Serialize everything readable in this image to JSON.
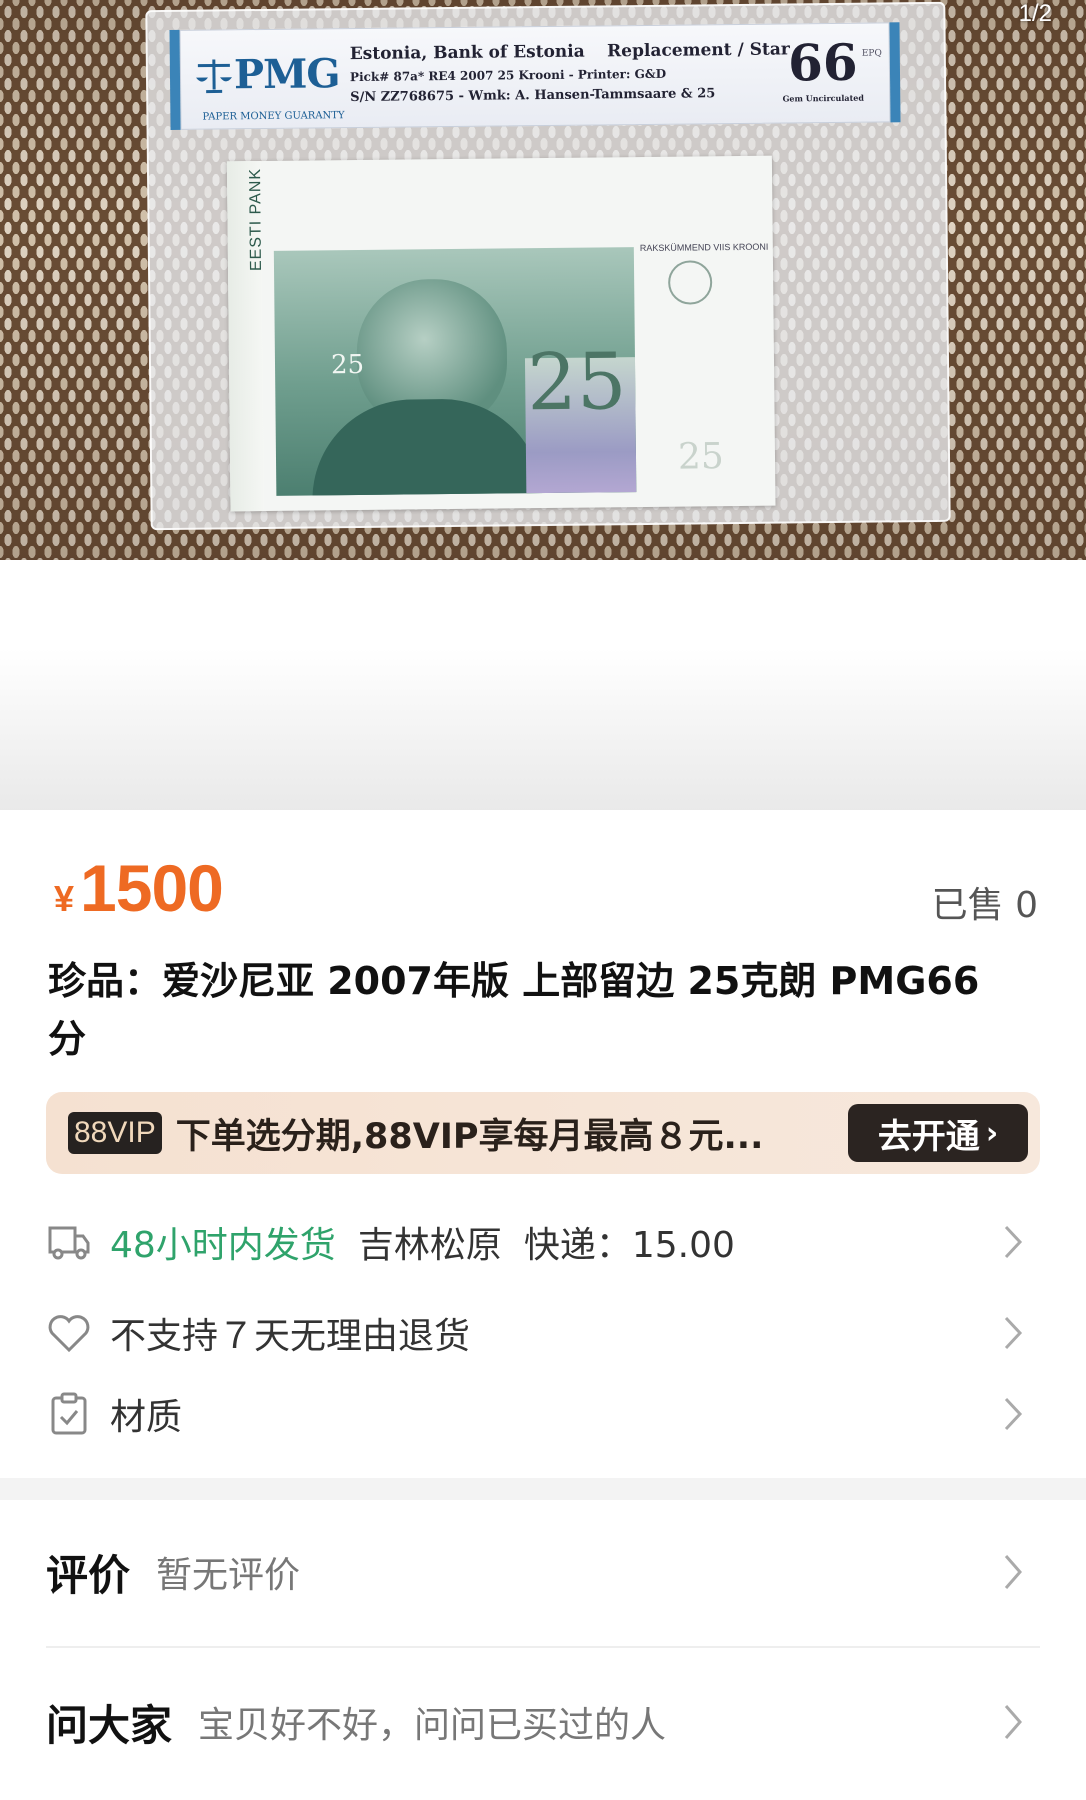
{
  "gallery": {
    "counter": "1/2"
  },
  "photo": {
    "label_brand": "PMG",
    "label_tagline": "PAPER MONEY GUARANTY",
    "label_issuer": "Estonia, Bank of Estonia",
    "label_type": "Replacement / Star",
    "label_pick": "Pick# 87a*   RE4    2007  25 Krooni - Printer: G&D",
    "label_serial": "S/N ZZ768675 - Wmk: A. Hansen-Tammsaare & 25",
    "grade_value": "66",
    "grade_desc": "Gem Uncirculated",
    "grade_epq": "EPQ",
    "note_bank": "EESTI PANK",
    "note_small_denom": "25",
    "note_big_denom": "25",
    "note_words": "RAKSKÜMMEND VIIS KROONI",
    "note_corner_denom": "25"
  },
  "product": {
    "currency": "¥",
    "price": "1500",
    "sold": "已售 0",
    "title": "珍品：爱沙尼亚 2007年版 上部留边 25克朗 PMG66分"
  },
  "vip": {
    "badge": "88VIP",
    "text": "下单选分期,88VIP享每月最高８元...",
    "button": "去开通"
  },
  "shipping": {
    "time": "48小时内发货",
    "location": "吉林松原",
    "fee": "快递：15.00"
  },
  "returns": {
    "text": "不支持７天无理由退货"
  },
  "material": {
    "text": "材质"
  },
  "reviews": {
    "title": "评价",
    "subtitle": "暂无评价"
  },
  "ask": {
    "title": "问大家",
    "subtitle": "宝贝好不好，问问已买过的人"
  },
  "colors": {
    "price": "#ee6a23",
    "shipping_time": "#2fa36b",
    "vip_bg": "#f5e1d1",
    "vip_button": "#2b2421"
  },
  "icons": [
    "truck-icon",
    "heart-icon",
    "clipboard-icon",
    "chevron-right-icon"
  ]
}
